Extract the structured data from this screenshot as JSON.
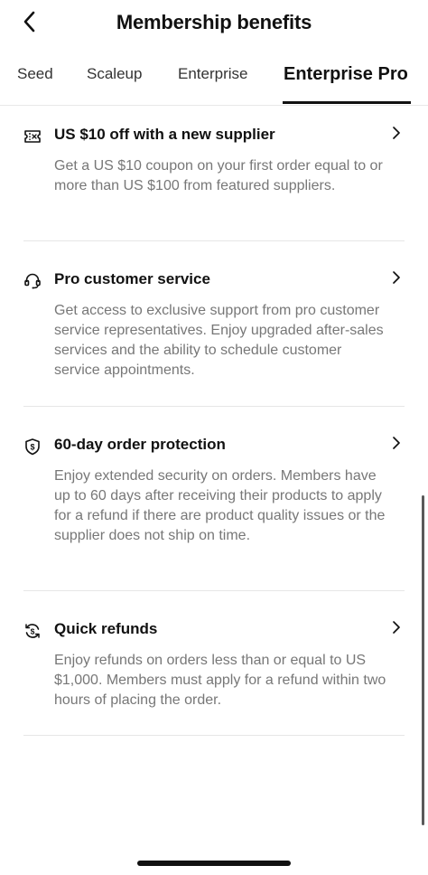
{
  "header": {
    "title": "Membership benefits"
  },
  "tabs": [
    {
      "label": "Seed",
      "active": false
    },
    {
      "label": "Scaleup",
      "active": false
    },
    {
      "label": "Enterprise",
      "active": false
    },
    {
      "label": "Enterprise Pro",
      "active": true
    }
  ],
  "benefits": [
    {
      "icon": "coupon-ticket-icon",
      "title": "US $10 off with a new supplier",
      "description": "Get a US $10 coupon on your first order equal to or more than US $100 from featured suppliers."
    },
    {
      "icon": "headset-icon",
      "title": "Pro customer service",
      "description": "Get access to exclusive support from pro customer service representatives. Enjoy upgraded after-sales services and the ability to schedule customer service appointments."
    },
    {
      "icon": "dollar-shield-icon",
      "title": "60-day order protection",
      "description": "Enjoy extended security on orders. Members have up to 60 days after receiving their products to apply for a refund if there are product quality issues or the supplier does not ship on time."
    },
    {
      "icon": "refund-cycle-icon",
      "title": "Quick refunds",
      "description": "Enjoy refunds on orders less than or equal to US $1,000. Members must apply for a refund within two hours of placing the order."
    }
  ]
}
